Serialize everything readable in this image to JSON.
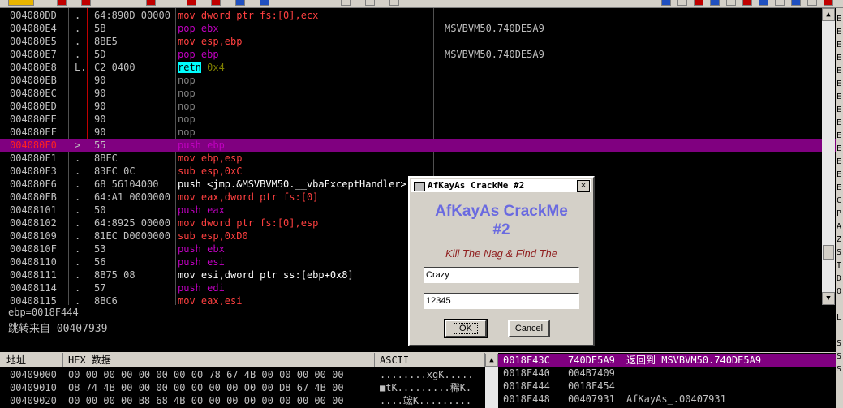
{
  "disasm": {
    "rows": [
      {
        "addr": "004080DD",
        "mark": ".",
        "hex": "64:890D 00000",
        "asm": "mov dword ptr fs:[0],ecx",
        "cls": "asm-red",
        "cmt": ""
      },
      {
        "addr": "004080E4",
        "mark": ".",
        "hex": "5B",
        "asm": "pop ebx",
        "cls": "asm-purple",
        "cmt": "MSVBVM50.740DE5A9"
      },
      {
        "addr": "004080E5",
        "mark": ".",
        "hex": "8BE5",
        "asm": "mov esp,ebp",
        "cls": "asm-red",
        "cmt": ""
      },
      {
        "addr": "004080E7",
        "mark": ".",
        "hex": "5D",
        "asm": "pop ebp",
        "cls": "asm-purple",
        "cmt": "MSVBVM50.740DE5A9"
      },
      {
        "addr": "004080E8",
        "mark": "L.",
        "hex": "C2 0400",
        "asm": "retn",
        "arg": "0x4",
        "cls": "asm-retn",
        "cmt": ""
      },
      {
        "addr": "004080EB",
        "mark": "",
        "hex": "90",
        "asm": "nop",
        "cls": "asm-gray",
        "cmt": ""
      },
      {
        "addr": "004080EC",
        "mark": "",
        "hex": "90",
        "asm": "nop",
        "cls": "asm-gray",
        "cmt": ""
      },
      {
        "addr": "004080ED",
        "mark": "",
        "hex": "90",
        "asm": "nop",
        "cls": "asm-gray",
        "cmt": ""
      },
      {
        "addr": "004080EE",
        "mark": "",
        "hex": "90",
        "asm": "nop",
        "cls": "asm-gray",
        "cmt": ""
      },
      {
        "addr": "004080EF",
        "mark": "",
        "hex": "90",
        "asm": "nop",
        "cls": "asm-gray",
        "cmt": ""
      },
      {
        "addr": "004080F0",
        "mark": ">",
        "hex": "55",
        "asm": "push ebp",
        "cls": "asm-purple",
        "cmt": "",
        "sel": true
      },
      {
        "addr": "004080F1",
        "mark": ".",
        "hex": "8BEC",
        "asm": "mov ebp,esp",
        "cls": "asm-red",
        "cmt": ""
      },
      {
        "addr": "004080F3",
        "mark": ".",
        "hex": "83EC 0C",
        "asm": "sub esp,0xC",
        "cls": "asm-red",
        "cmt": ""
      },
      {
        "addr": "004080F6",
        "mark": ".",
        "hex": "68 56104000",
        "asm": "push <jmp.&MSVBVM50.__vbaExceptHandler>",
        "cls": "asm-call",
        "cmt": ""
      },
      {
        "addr": "004080FB",
        "mark": ".",
        "hex": "64:A1 0000000",
        "asm": "mov eax,dword ptr fs:[0]",
        "cls": "asm-red",
        "cmt": ""
      },
      {
        "addr": "00408101",
        "mark": ".",
        "hex": "50",
        "asm": "push eax",
        "cls": "asm-purple",
        "cmt": ""
      },
      {
        "addr": "00408102",
        "mark": ".",
        "hex": "64:8925 00000",
        "asm": "mov dword ptr fs:[0],esp",
        "cls": "asm-red",
        "cmt": ""
      },
      {
        "addr": "00408109",
        "mark": ".",
        "hex": "81EC D0000000",
        "asm": "sub esp,0xD0",
        "cls": "asm-red",
        "cmt": ""
      },
      {
        "addr": "0040810F",
        "mark": ".",
        "hex": "53",
        "asm": "push ebx",
        "cls": "asm-purple",
        "cmt": ""
      },
      {
        "addr": "00408110",
        "mark": ".",
        "hex": "56",
        "asm": "push esi",
        "cls": "asm-purple",
        "cmt": ""
      },
      {
        "addr": "00408111",
        "mark": ".",
        "hex": "8B75 08",
        "asm": "mov esi,dword ptr ss:[ebp+0x8]",
        "cls": "asm-call",
        "cmt": ""
      },
      {
        "addr": "00408114",
        "mark": ".",
        "hex": "57",
        "asm": "push edi",
        "cls": "asm-purple",
        "cmt": ""
      },
      {
        "addr": "00408115",
        "mark": ".",
        "hex": "8BC6",
        "asm": "mov eax,esi",
        "cls": "asm-red",
        "cmt": ""
      }
    ]
  },
  "info": {
    "line1": "ebp=0018F444",
    "line2": "跳转来自 00407939"
  },
  "dump": {
    "headers": [
      "地址",
      "HEX 数据",
      "ASCII"
    ],
    "rows": [
      {
        "addr": "00409000",
        "hex": "00 00 00 00 00 00 00 00 78 67 4B 00 00 00 00 00",
        "ascii": "........xgK....."
      },
      {
        "addr": "00409010",
        "hex": "08 74 4B 00 00 00 00 00 00 00 00 00 D8 67 4B 00",
        "ascii": "■tK.........稀K."
      },
      {
        "addr": "00409020",
        "hex": "00 00 00 00 B8 68 4B 00 00 00 00 00 00 00 00 00",
        "ascii": "....竤K........."
      }
    ]
  },
  "stack": {
    "rows": [
      {
        "addr": "0018F43C",
        "val": "740DE5A9",
        "cmt": "返回到 MSVBVM50.740DE5A9",
        "sel": true
      },
      {
        "addr": "0018F440",
        "val": "004B7409",
        "cmt": ""
      },
      {
        "addr": "0018F444",
        "val": "0018F454",
        "cmt": ""
      },
      {
        "addr": "0018F448",
        "val": "00407931",
        "cmt": "AfKayAs_.00407931"
      }
    ]
  },
  "dialog": {
    "title": "AfKayAs CrackMe #2",
    "heading_line1": "AfKayAs CrackMe",
    "heading_line2": "#2",
    "subtitle": "Kill The Nag & Find The",
    "name_value": "Crazy",
    "serial_value": "12345",
    "ok_label": "OK",
    "cancel_label": "Cancel",
    "close_glyph": "✕"
  },
  "regstrip": [
    "E",
    "E",
    "E",
    "E",
    "E",
    "E",
    "E",
    "E",
    "E",
    "E",
    "E",
    "E",
    "E",
    "E",
    "C",
    "P",
    "A",
    "Z",
    "S",
    "T",
    "D",
    "O",
    "",
    "L",
    "",
    "S",
    "S",
    "S"
  ]
}
